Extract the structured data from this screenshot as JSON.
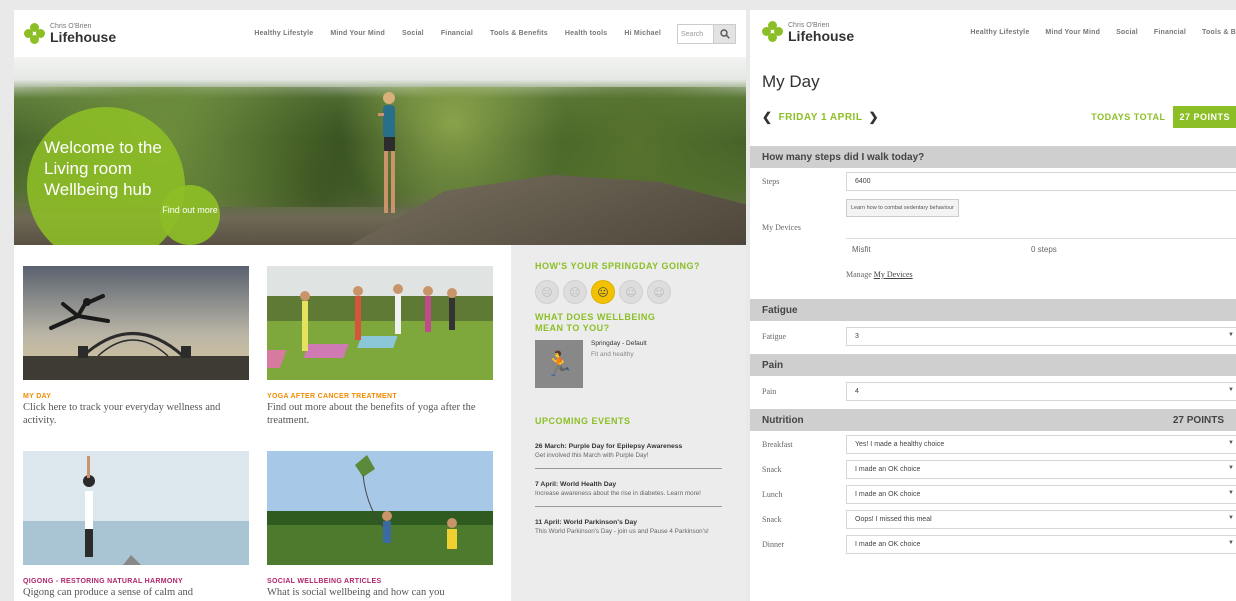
{
  "left": {
    "logo": {
      "small": "Chris O'Brien",
      "big": "Lifehouse"
    },
    "nav": [
      "Healthy Lifestyle",
      "Mind Your Mind",
      "Social",
      "Financial",
      "Tools & Benefits",
      "Health tools",
      "Hi Michael"
    ],
    "search_placeholder": "Search",
    "hero": {
      "title": "Welcome to the Living room Wellbeing hub",
      "cta": "Find out more"
    },
    "cards": [
      {
        "tag": "MY DAY",
        "tag_color": "#f28c00",
        "desc": "Click here to track your everyday wellness and activity."
      },
      {
        "tag": "YOGA AFTER CANCER TREATMENT",
        "tag_color": "#f28c00",
        "desc": "Find out more about the benefits of yoga after the treatment."
      },
      {
        "tag": "QIGONG - RESTORING NATURAL HARMONY",
        "tag_color": "#b0246a",
        "desc": "Qigong can produce a sense of calm and"
      },
      {
        "tag": "SOCIAL WELLBEING ARTICLES",
        "tag_color": "#b0246a",
        "desc": "What is social wellbeing and how can you"
      }
    ],
    "sidebar": {
      "springday_q": "HOW'S YOUR SPRINGDAY GOING?",
      "wellbeing_q": "WHAT DOES WELLBEING MEAN TO YOU?",
      "default_title": "Springday - Default",
      "default_sub": "Fit and healthy",
      "events_title": "UPCOMING EVENTS",
      "events": [
        {
          "title": "26 March: Purple Day for Epilepsy Awareness",
          "desc": "Get involved this March with Purple Day!"
        },
        {
          "title": "7 April: World Health Day",
          "desc": "Increase awareness about the rise in diabetes. Learn more!"
        },
        {
          "title": "11 April: World Parkinson's Day",
          "desc": "This World Parkinson's Day - join us and Pause 4 Parkinson's!"
        }
      ]
    }
  },
  "right": {
    "logo": {
      "small": "Chris O'Brien",
      "big": "Lifehouse"
    },
    "nav": [
      "Healthy Lifestyle",
      "Mind Your Mind",
      "Social",
      "Financial",
      "Tools & B"
    ],
    "title": "My Day",
    "date": "FRIDAY 1 APRIL",
    "todays_total_label": "TODAYS TOTAL",
    "todays_total_value": "27 POINTS",
    "steps_section": "How many steps did I walk today?",
    "steps_label": "Steps",
    "steps_value": "6400",
    "sedentary_btn": "Learn how to combat sedentary behaviour",
    "devices_label": "My Devices",
    "device_name": "Misfit",
    "device_steps": "0 steps",
    "manage_prefix": "Manage",
    "manage_link": "My Devices",
    "fatigue_section": "Fatigue",
    "fatigue_label": "Fatigue",
    "fatigue_value": "3",
    "pain_section": "Pain",
    "pain_label": "Pain",
    "pain_value": "4",
    "nutrition_section": "Nutrition",
    "nutrition_points": "27 POINTS",
    "meals": [
      {
        "label": "Breakfast",
        "value": "Yes! I made a healthy choice"
      },
      {
        "label": "Snack",
        "value": "I made an OK choice"
      },
      {
        "label": "Lunch",
        "value": "I made an OK choice"
      },
      {
        "label": "Snack",
        "value": "Oops! I missed this meal"
      },
      {
        "label": "Dinner",
        "value": "I made an OK choice"
      }
    ]
  }
}
